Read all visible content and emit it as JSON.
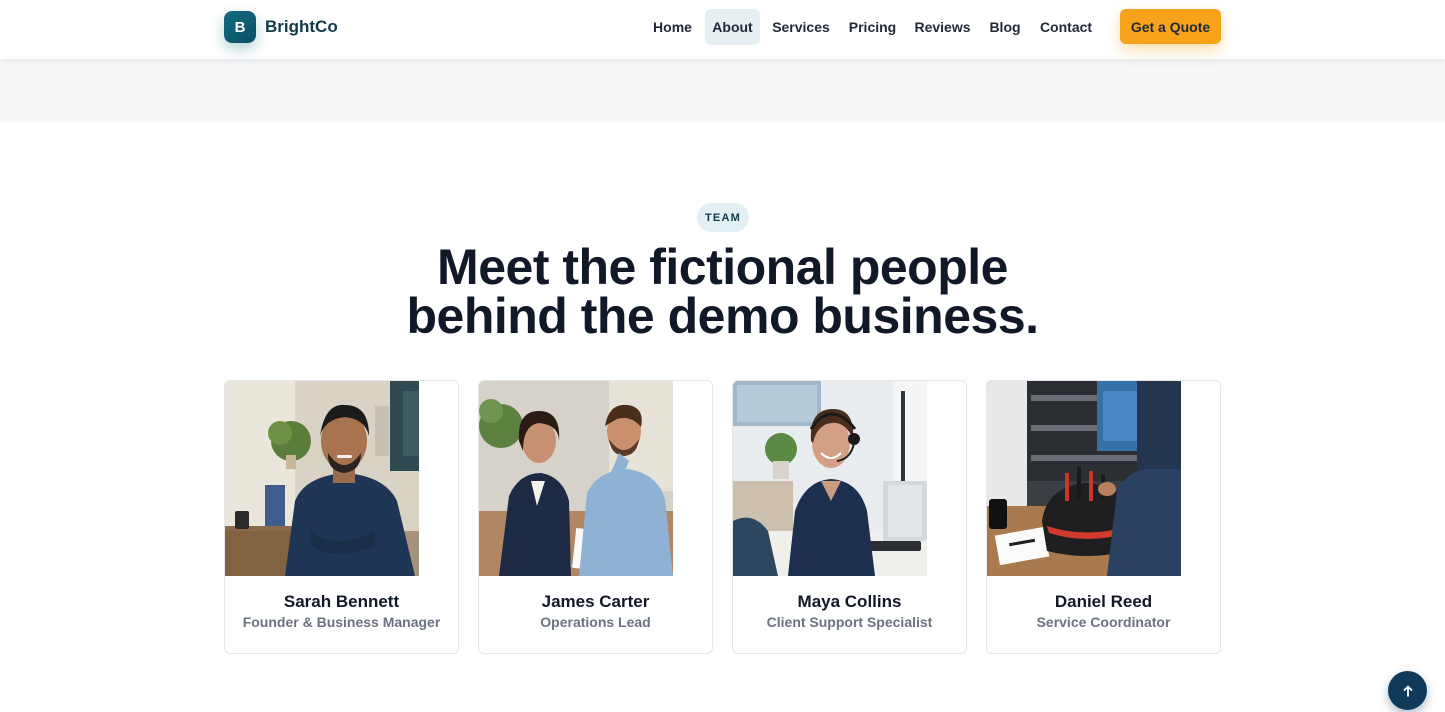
{
  "header": {
    "logo_letter": "B",
    "brand": "BrightCo",
    "nav": [
      {
        "label": "Home",
        "active": false
      },
      {
        "label": "About",
        "active": true
      },
      {
        "label": "Services",
        "active": false
      },
      {
        "label": "Pricing",
        "active": false
      },
      {
        "label": "Reviews",
        "active": false
      },
      {
        "label": "Blog",
        "active": false
      },
      {
        "label": "Contact",
        "active": false
      }
    ],
    "cta_label": "Get a Quote"
  },
  "team": {
    "eyebrow": "TEAM",
    "headline_line1": "Meet the fictional people",
    "headline_line2": "behind the demo business.",
    "members": [
      {
        "name": "Sarah Bennett",
        "role": "Founder & Business Manager",
        "photo": "man-seated-office-portrait"
      },
      {
        "name": "James Carter",
        "role": "Operations Lead",
        "photo": "two-colleagues-reviewing-reports"
      },
      {
        "name": "Maya Collins",
        "role": "Client Support Specialist",
        "photo": "support-agent-with-headset"
      },
      {
        "name": "Daniel Reed",
        "role": "Service Coordinator",
        "photo": "technician-tool-bag-in-van"
      }
    ]
  },
  "scroll_top_icon": "arrow-up-icon",
  "colors": {
    "brand": "#136b80",
    "accent": "#f7a21b",
    "heading": "#111827",
    "muted": "#6b7280"
  }
}
